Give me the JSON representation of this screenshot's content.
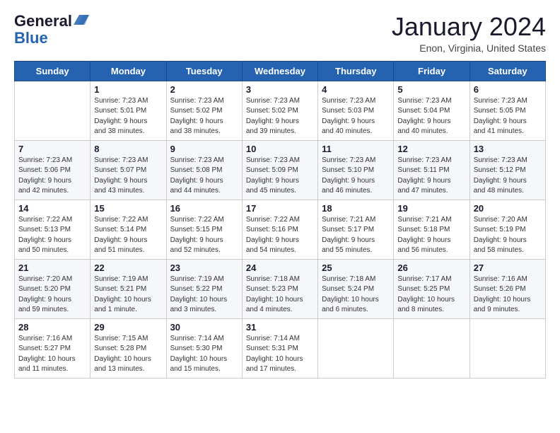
{
  "logo": {
    "line1": "General",
    "line2": "Blue"
  },
  "title": "January 2024",
  "location": "Enon, Virginia, United States",
  "days_of_week": [
    "Sunday",
    "Monday",
    "Tuesday",
    "Wednesday",
    "Thursday",
    "Friday",
    "Saturday"
  ],
  "weeks": [
    [
      {
        "day": "",
        "info": ""
      },
      {
        "day": "1",
        "info": "Sunrise: 7:23 AM\nSunset: 5:01 PM\nDaylight: 9 hours\nand 38 minutes."
      },
      {
        "day": "2",
        "info": "Sunrise: 7:23 AM\nSunset: 5:02 PM\nDaylight: 9 hours\nand 38 minutes."
      },
      {
        "day": "3",
        "info": "Sunrise: 7:23 AM\nSunset: 5:02 PM\nDaylight: 9 hours\nand 39 minutes."
      },
      {
        "day": "4",
        "info": "Sunrise: 7:23 AM\nSunset: 5:03 PM\nDaylight: 9 hours\nand 40 minutes."
      },
      {
        "day": "5",
        "info": "Sunrise: 7:23 AM\nSunset: 5:04 PM\nDaylight: 9 hours\nand 40 minutes."
      },
      {
        "day": "6",
        "info": "Sunrise: 7:23 AM\nSunset: 5:05 PM\nDaylight: 9 hours\nand 41 minutes."
      }
    ],
    [
      {
        "day": "7",
        "info": "Sunrise: 7:23 AM\nSunset: 5:06 PM\nDaylight: 9 hours\nand 42 minutes."
      },
      {
        "day": "8",
        "info": "Sunrise: 7:23 AM\nSunset: 5:07 PM\nDaylight: 9 hours\nand 43 minutes."
      },
      {
        "day": "9",
        "info": "Sunrise: 7:23 AM\nSunset: 5:08 PM\nDaylight: 9 hours\nand 44 minutes."
      },
      {
        "day": "10",
        "info": "Sunrise: 7:23 AM\nSunset: 5:09 PM\nDaylight: 9 hours\nand 45 minutes."
      },
      {
        "day": "11",
        "info": "Sunrise: 7:23 AM\nSunset: 5:10 PM\nDaylight: 9 hours\nand 46 minutes."
      },
      {
        "day": "12",
        "info": "Sunrise: 7:23 AM\nSunset: 5:11 PM\nDaylight: 9 hours\nand 47 minutes."
      },
      {
        "day": "13",
        "info": "Sunrise: 7:23 AM\nSunset: 5:12 PM\nDaylight: 9 hours\nand 48 minutes."
      }
    ],
    [
      {
        "day": "14",
        "info": "Sunrise: 7:22 AM\nSunset: 5:13 PM\nDaylight: 9 hours\nand 50 minutes."
      },
      {
        "day": "15",
        "info": "Sunrise: 7:22 AM\nSunset: 5:14 PM\nDaylight: 9 hours\nand 51 minutes."
      },
      {
        "day": "16",
        "info": "Sunrise: 7:22 AM\nSunset: 5:15 PM\nDaylight: 9 hours\nand 52 minutes."
      },
      {
        "day": "17",
        "info": "Sunrise: 7:22 AM\nSunset: 5:16 PM\nDaylight: 9 hours\nand 54 minutes."
      },
      {
        "day": "18",
        "info": "Sunrise: 7:21 AM\nSunset: 5:17 PM\nDaylight: 9 hours\nand 55 minutes."
      },
      {
        "day": "19",
        "info": "Sunrise: 7:21 AM\nSunset: 5:18 PM\nDaylight: 9 hours\nand 56 minutes."
      },
      {
        "day": "20",
        "info": "Sunrise: 7:20 AM\nSunset: 5:19 PM\nDaylight: 9 hours\nand 58 minutes."
      }
    ],
    [
      {
        "day": "21",
        "info": "Sunrise: 7:20 AM\nSunset: 5:20 PM\nDaylight: 9 hours\nand 59 minutes."
      },
      {
        "day": "22",
        "info": "Sunrise: 7:19 AM\nSunset: 5:21 PM\nDaylight: 10 hours\nand 1 minute."
      },
      {
        "day": "23",
        "info": "Sunrise: 7:19 AM\nSunset: 5:22 PM\nDaylight: 10 hours\nand 3 minutes."
      },
      {
        "day": "24",
        "info": "Sunrise: 7:18 AM\nSunset: 5:23 PM\nDaylight: 10 hours\nand 4 minutes."
      },
      {
        "day": "25",
        "info": "Sunrise: 7:18 AM\nSunset: 5:24 PM\nDaylight: 10 hours\nand 6 minutes."
      },
      {
        "day": "26",
        "info": "Sunrise: 7:17 AM\nSunset: 5:25 PM\nDaylight: 10 hours\nand 8 minutes."
      },
      {
        "day": "27",
        "info": "Sunrise: 7:16 AM\nSunset: 5:26 PM\nDaylight: 10 hours\nand 9 minutes."
      }
    ],
    [
      {
        "day": "28",
        "info": "Sunrise: 7:16 AM\nSunset: 5:27 PM\nDaylight: 10 hours\nand 11 minutes."
      },
      {
        "day": "29",
        "info": "Sunrise: 7:15 AM\nSunset: 5:28 PM\nDaylight: 10 hours\nand 13 minutes."
      },
      {
        "day": "30",
        "info": "Sunrise: 7:14 AM\nSunset: 5:30 PM\nDaylight: 10 hours\nand 15 minutes."
      },
      {
        "day": "31",
        "info": "Sunrise: 7:14 AM\nSunset: 5:31 PM\nDaylight: 10 hours\nand 17 minutes."
      },
      {
        "day": "",
        "info": ""
      },
      {
        "day": "",
        "info": ""
      },
      {
        "day": "",
        "info": ""
      }
    ]
  ]
}
